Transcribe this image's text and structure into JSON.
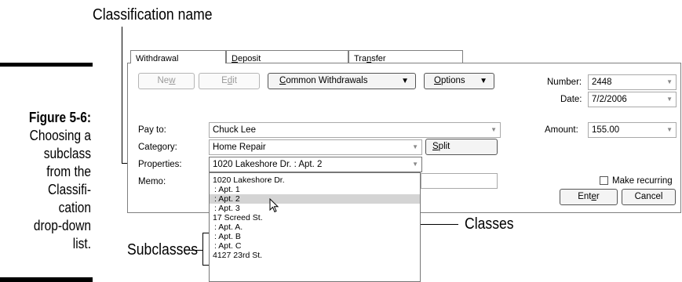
{
  "figure": {
    "number": "Figure 5-6:",
    "caption_lines": [
      "Choosing a",
      "subclass",
      "from the",
      "Classifi-",
      "cation",
      "drop-down",
      "list."
    ]
  },
  "callouts": {
    "classification_name": "Classification name",
    "classes": "Classes",
    "subclasses": "Subclasses"
  },
  "tabs": [
    {
      "label_pre": "With",
      "label_u": "d",
      "label_post": "rawal"
    },
    {
      "label_pre": "",
      "label_u": "D",
      "label_post": "eposit"
    },
    {
      "label_pre": "Tra",
      "label_u": "n",
      "label_post": "sfer"
    }
  ],
  "toolbar": {
    "new": {
      "pre": "Ne",
      "u": "w",
      "post": ""
    },
    "edit": {
      "pre": "E",
      "u": "d",
      "post": "it"
    },
    "transaction_type": {
      "pre": "",
      "u": "C",
      "post": "ommon Withdrawals"
    },
    "options": {
      "pre": "",
      "u": "O",
      "post": "ptions"
    }
  },
  "form": {
    "number_label": "Number:",
    "number_value": "2448",
    "date_label": "Date:",
    "date_value": "7/2/2006",
    "pay_to_label": "Pay to:",
    "pay_to_value": "Chuck Lee",
    "amount_label": "Amount:",
    "amount_value": "155.00",
    "category_label": "Category:",
    "category_value": "Home Repair",
    "split": {
      "pre": "",
      "u": "S",
      "post": "plit"
    },
    "properties_label": "Properties:",
    "properties_value": "1020 Lakeshore Dr. : Apt. 2",
    "memo_label": "Memo:",
    "make_recurring_label": "Make recurring",
    "make_recurring_checked": false,
    "enter": {
      "pre": "Ent",
      "u": "e",
      "post": "r"
    },
    "cancel": "Cancel"
  },
  "classification_list": {
    "items": [
      {
        "text": "1020 Lakeshore Dr.",
        "level": "class"
      },
      {
        "text": ": Apt. 1",
        "level": "subclass"
      },
      {
        "text": ": Apt. 2",
        "level": "subclass",
        "selected": true
      },
      {
        "text": ": Apt. 3",
        "level": "subclass"
      },
      {
        "text": "17 Screed St.",
        "level": "class"
      },
      {
        "text": ": Apt. A.",
        "level": "subclass"
      },
      {
        "text": ": Apt. B",
        "level": "subclass"
      },
      {
        "text": ": Apt. C",
        "level": "subclass"
      },
      {
        "text": "4127 23rd St.",
        "level": "class"
      }
    ]
  },
  "colors": {
    "selected_row": "#d4d4d4",
    "border": "#7f7f7f"
  },
  "icons": [
    "dropdown-arrow-icon",
    "mouse-pointer-icon",
    "checkbox-icon"
  ]
}
